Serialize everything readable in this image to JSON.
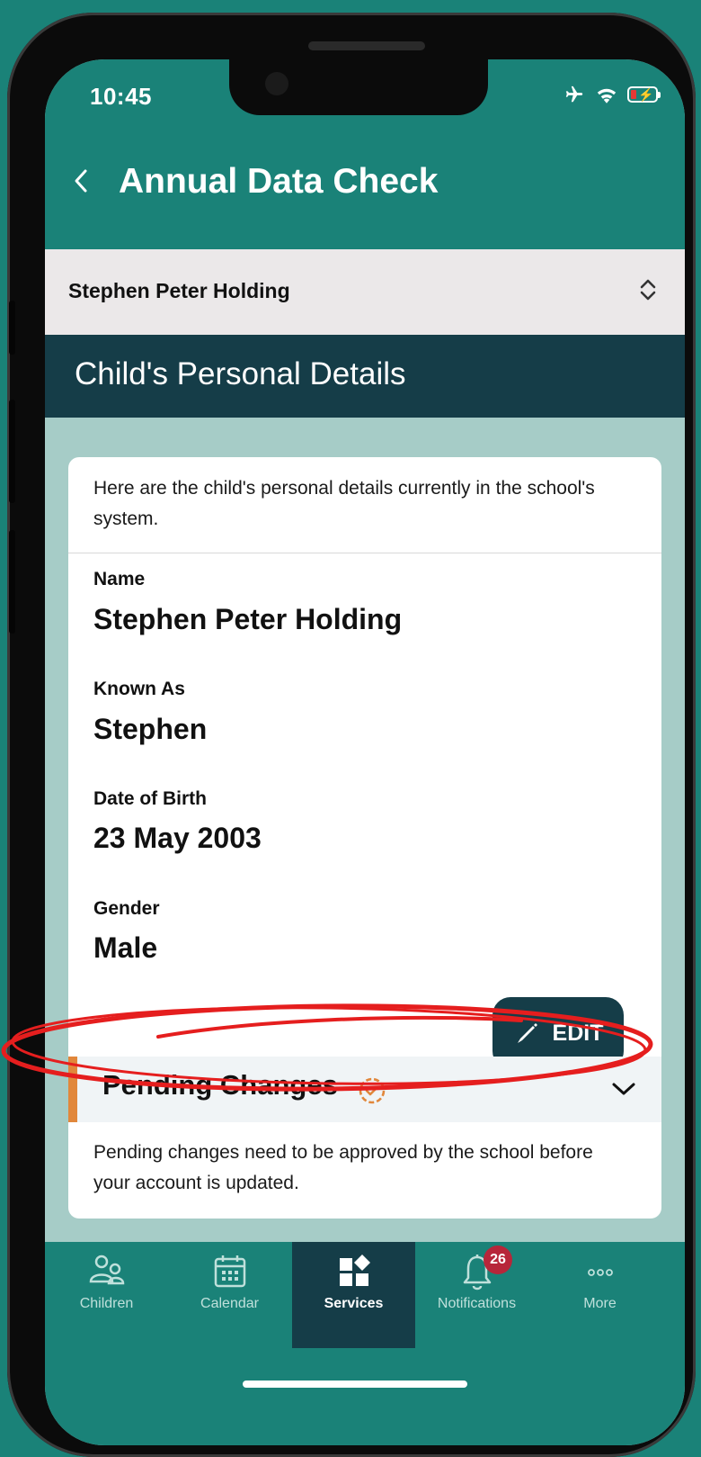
{
  "status": {
    "time": "10:45"
  },
  "header": {
    "back_icon": "chevron-left-icon",
    "title": "Annual Data Check"
  },
  "child_selector": {
    "selected": "Stephen Peter Holding"
  },
  "section": {
    "title": "Child's Personal Details"
  },
  "card": {
    "intro": "Here are the child's personal details currently in the school's system.",
    "fields": [
      {
        "label": "Name",
        "value": "Stephen Peter Holding"
      },
      {
        "label": "Known As",
        "value": "Stephen"
      },
      {
        "label": "Date of Birth",
        "value": "23 May 2003"
      },
      {
        "label": "Gender",
        "value": "Male"
      }
    ],
    "edit_label": "EDIT",
    "pending": {
      "title": "Pending Changes",
      "note": "Pending changes need to be approved by the school before your account is updated."
    }
  },
  "tabs": [
    {
      "label": "Children",
      "icon": "children-icon"
    },
    {
      "label": "Calendar",
      "icon": "calendar-icon"
    },
    {
      "label": "Services",
      "icon": "services-icon",
      "active": true
    },
    {
      "label": "Notifications",
      "icon": "bell-icon",
      "badge": "26"
    },
    {
      "label": "More",
      "icon": "more-icon"
    }
  ],
  "colors": {
    "brand_teal": "#1a8278",
    "navy": "#153d48",
    "pending_orange": "#e1873b",
    "highlight_red": "#e51e1e",
    "badge_red": "#b7263a"
  }
}
